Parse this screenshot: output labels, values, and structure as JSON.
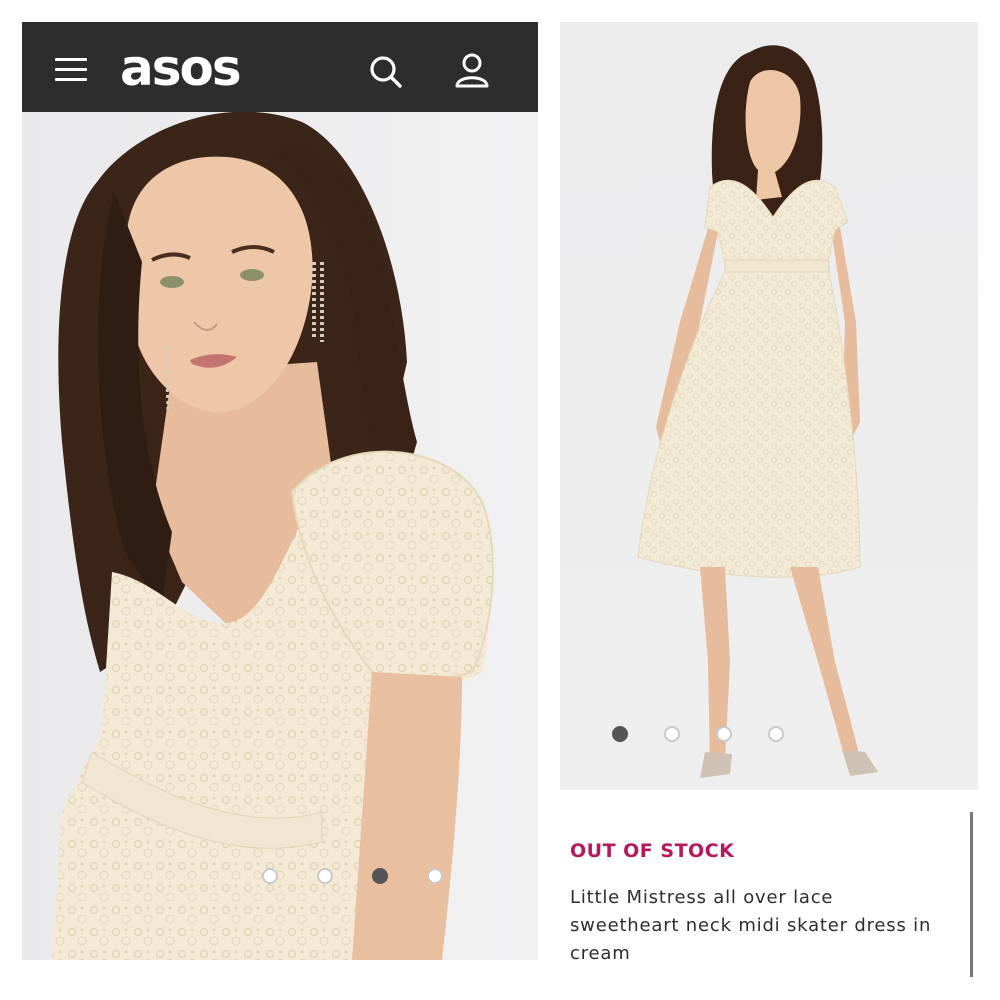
{
  "header": {
    "logo": "asos",
    "menu_icon": "hamburger-menu-icon",
    "search_icon": "search-icon",
    "account_icon": "account-icon",
    "background": "#2d2d2d"
  },
  "gallery_left": {
    "dot_count": 4,
    "active_index": 2
  },
  "gallery_right": {
    "dot_count": 4,
    "active_index": 0
  },
  "product": {
    "stock_status": "OUT OF STOCK",
    "stock_color": "#b5185d",
    "title": "Little Mistress all over lace sweetheart neck midi skater dress in cream"
  }
}
